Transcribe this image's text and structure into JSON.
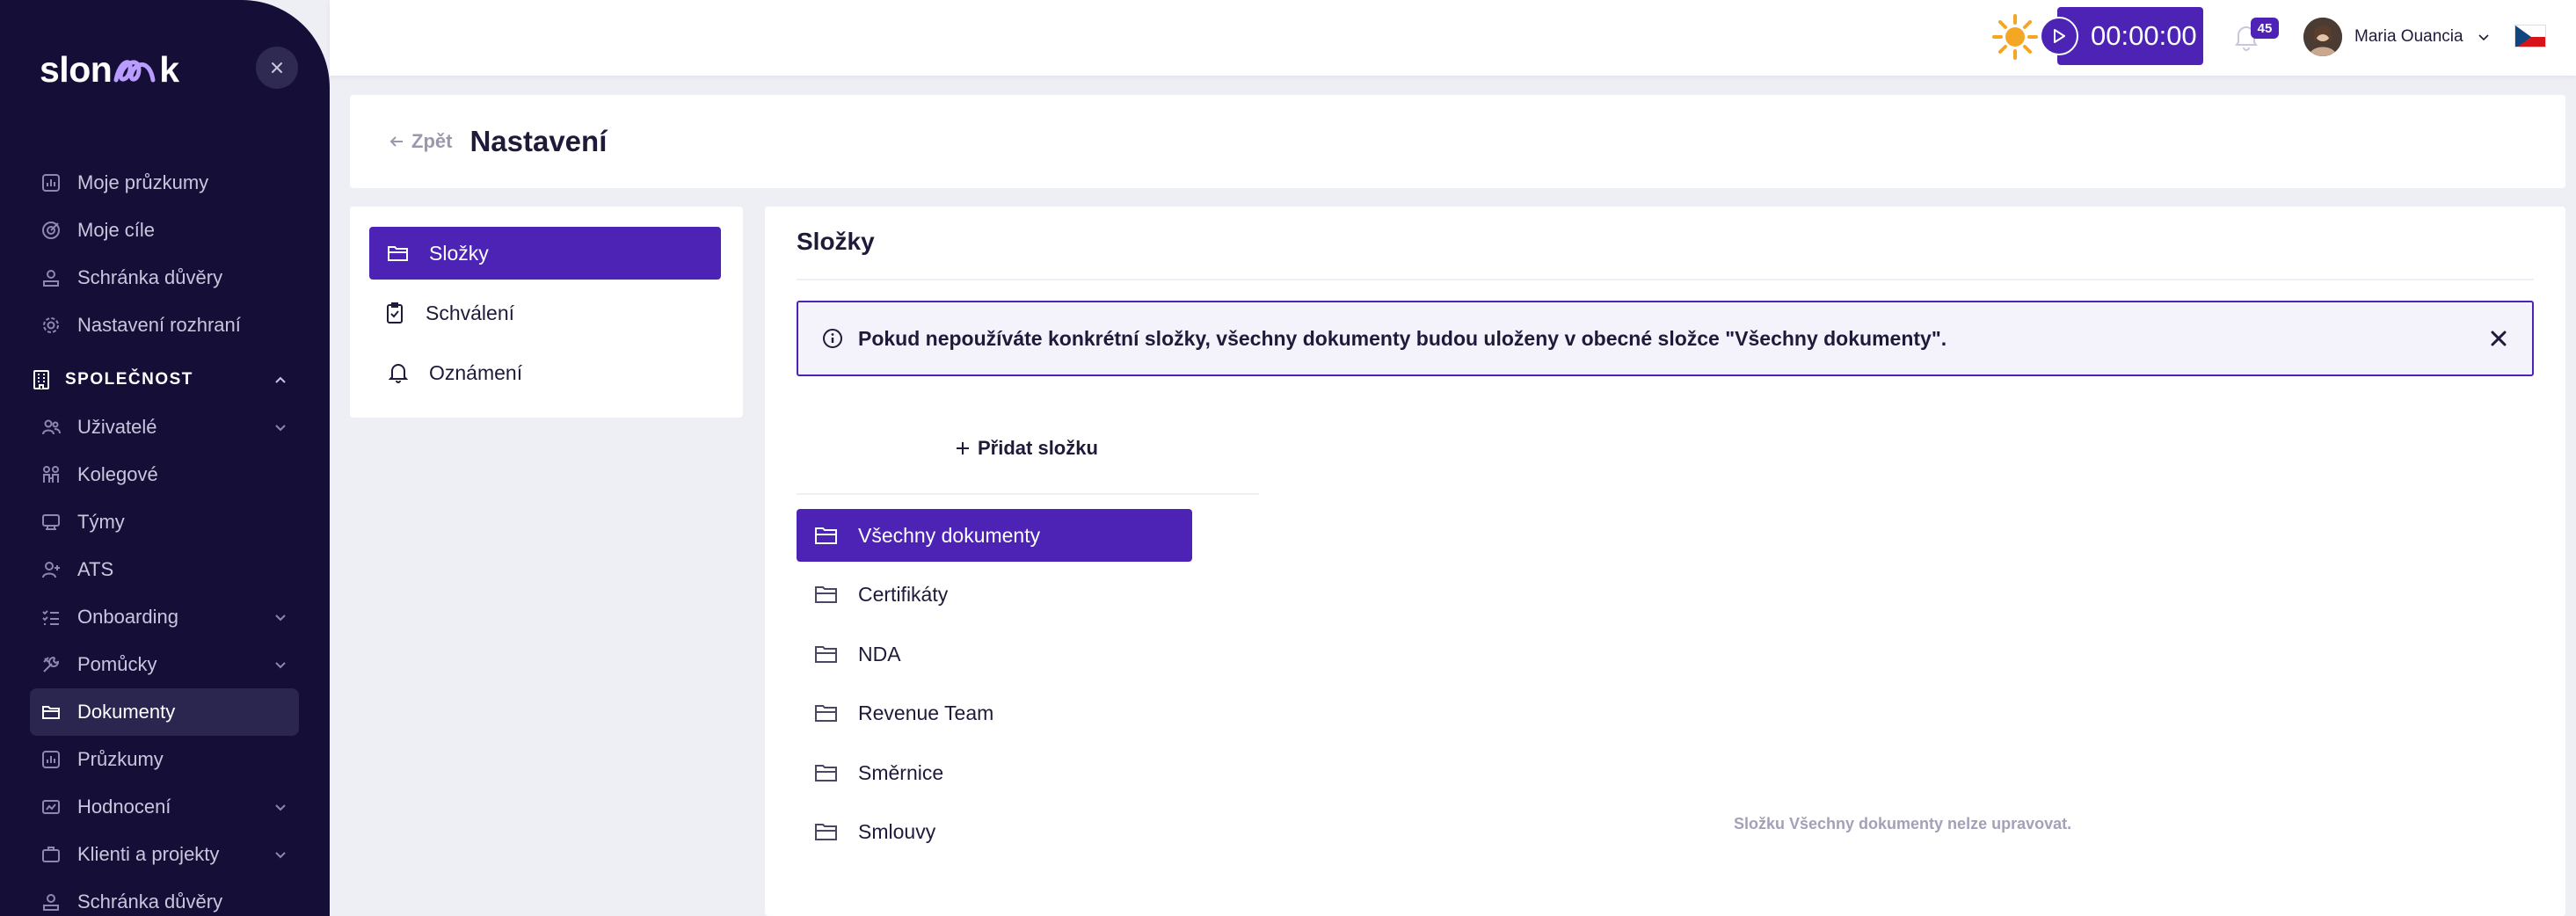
{
  "sidebar": {
    "logo": {
      "part1": "slon",
      "part2": "k"
    },
    "items_top": [
      {
        "label": "Moje průzkumy",
        "icon": "chart-box-icon"
      },
      {
        "label": "Moje cíle",
        "icon": "target-icon"
      },
      {
        "label": "Schránka důvěry",
        "icon": "trust-box-icon"
      },
      {
        "label": "Nastavení rozhraní",
        "icon": "gear-icon"
      }
    ],
    "section": {
      "label": "SPOLEČNOST",
      "icon": "building-icon"
    },
    "items_company": [
      {
        "label": "Uživatelé",
        "icon": "users-icon",
        "has_children": true
      },
      {
        "label": "Kolegové",
        "icon": "colleagues-icon",
        "has_children": false
      },
      {
        "label": "Týmy",
        "icon": "teams-icon",
        "has_children": false
      },
      {
        "label": "ATS",
        "icon": "user-plus-icon",
        "has_children": false
      },
      {
        "label": "Onboarding",
        "icon": "list-check-icon",
        "has_children": true
      },
      {
        "label": "Pomůcky",
        "icon": "tools-icon",
        "has_children": true
      },
      {
        "label": "Dokumenty",
        "icon": "folder-icon",
        "has_children": false,
        "active": true
      },
      {
        "label": "Průzkumy",
        "icon": "chart-box-icon",
        "has_children": false
      },
      {
        "label": "Hodnocení",
        "icon": "rating-icon",
        "has_children": true
      },
      {
        "label": "Klienti a projekty",
        "icon": "briefcase-icon",
        "has_children": true
      },
      {
        "label": "Schránka důvěry",
        "icon": "trust-box-icon",
        "has_children": false
      }
    ]
  },
  "topbar": {
    "timer": "00:00:00",
    "notifications_count": "45",
    "user_name": "Maria Ouancia"
  },
  "page": {
    "back_label": "Zpět",
    "title": "Nastavení"
  },
  "settings_menu": [
    {
      "label": "Složky",
      "icon": "folder-icon",
      "active": true
    },
    {
      "label": "Schválení",
      "icon": "clipboard-check-icon",
      "active": false
    },
    {
      "label": "Oznámení",
      "icon": "bell-icon",
      "active": false
    }
  ],
  "folders_panel": {
    "title": "Složky",
    "alert": "Pokud nepoužíváte konkrétní složky, všechny dokumenty budou uloženy v obecné složce \"Všechny dokumenty\".",
    "add_folder_label": "Přidat složku",
    "folders": [
      {
        "label": "Všechny dokumenty",
        "active": true
      },
      {
        "label": "Certifikáty",
        "active": false
      },
      {
        "label": "NDA",
        "active": false
      },
      {
        "label": "Revenue Team",
        "active": false
      },
      {
        "label": "Směrnice",
        "active": false
      },
      {
        "label": "Smlouvy",
        "active": false
      }
    ],
    "note": "Složku Všechny dokumenty nelze upravovat."
  },
  "colors": {
    "sidebar_bg": "#150f38",
    "accent": "#4c23b5",
    "page_bg": "#eeeff5"
  }
}
